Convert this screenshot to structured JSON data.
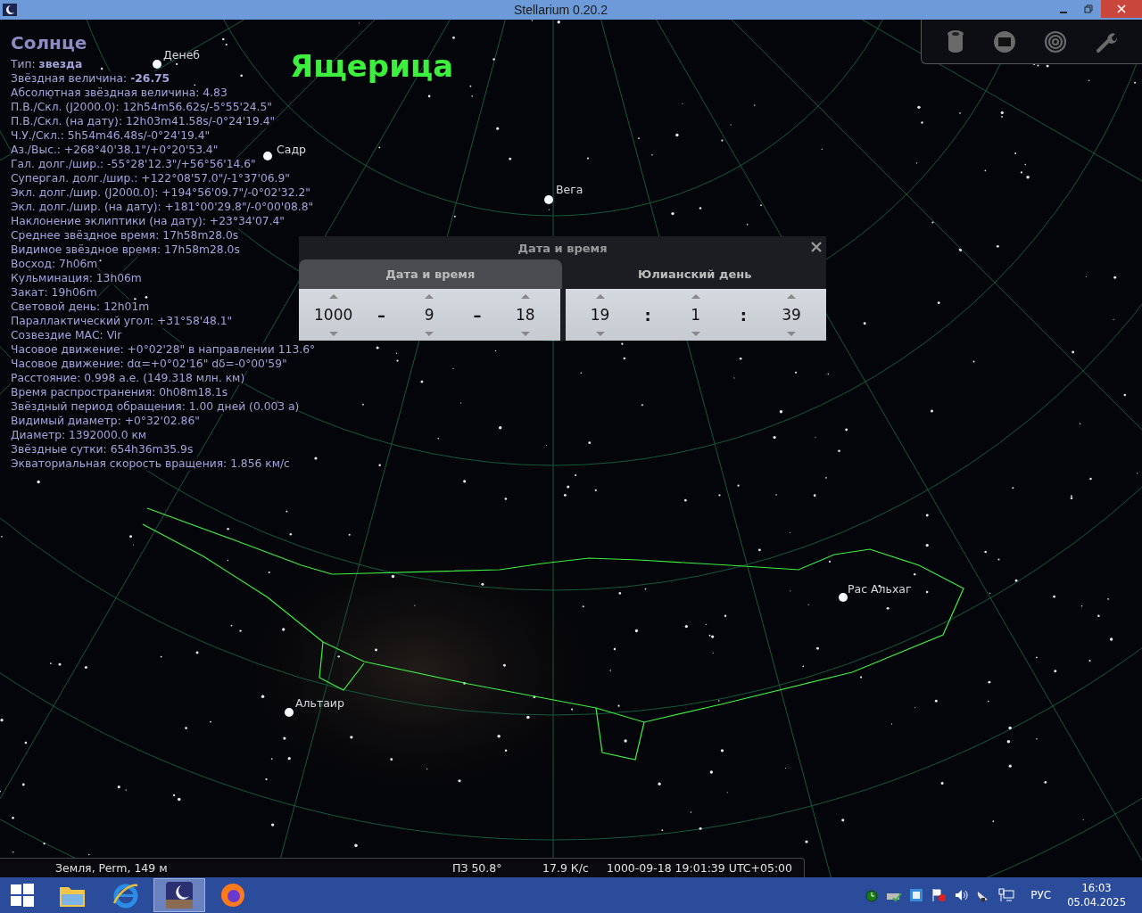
{
  "window": {
    "title": "Stellarium 0.20.2"
  },
  "info": {
    "name": "Солнце",
    "lines": [
      "Тип: **звезда**",
      "Звёздная величина: **-26.75**",
      "Абсолютная звёздная величина: 4.83",
      "П.В./Скл. (J2000.0): 12h54m56.62s/-5°55'24.5\"",
      "П.В./Скл. (на дату): 12h03m41.58s/-0°24'19.4\"",
      "Ч.У./Скл.: 5h54m46.48s/-0°24'19.4\"",
      "Аз./Выс.: +268°40'38.1\"/+0°20'53.4\"",
      "Гал. долг./шир.: -55°28'12.3\"/+56°56'14.6\"",
      "Супергал. долг./шир.: +122°08'57.0\"/-1°37'06.9\"",
      "Экл. долг./шир. (J2000.0): +194°56'09.7\"/-0°02'32.2\"",
      "Экл. долг./шир. (на дату): +181°00'29.8\"/-0°00'08.8\"",
      "Наклонение эклиптики (на дату): +23°34'07.4\"",
      "Среднее звёздное время: 17h58m28.0s",
      "Видимое звёздное время: 17h58m28.0s",
      "Восход: 7h06m",
      "Кульминация: 13h06m",
      "Закат: 19h06m",
      "Световой день: 12h01m",
      "Параллактический угол: +31°58'48.1\"",
      "Созвездие МАС: Vir",
      "Часовое движение: +0°02'28\" в направлении 113.6°",
      "Часовое движение: dα=+0°02'16\" dδ=-0°00'59\"",
      "Расстояние: 0.998 а.е. (149.318 млн. км)",
      "Время распространения: 0h08m18.1s",
      "Звёздный период обращения: 1.00 дней (0.003 а)",
      "Видимый диаметр: +0°32'02.86\"",
      "Диаметр: 1392000.0 км",
      "Звёздные сутки: 654h36m35.9s",
      "Экваториальная скорость вращения: 1.856 км/с"
    ]
  },
  "constellation": {
    "name": "Ящерица"
  },
  "star_labels": [
    {
      "label": "Денеб"
    },
    {
      "label": "Садр"
    },
    {
      "label": "Вега"
    },
    {
      "label": "Рас Альхаг"
    },
    {
      "label": "Альтаир"
    }
  ],
  "dialog": {
    "title": "Дата и время",
    "tabs": [
      {
        "label": "Дата и время",
        "selected": true
      },
      {
        "label": "Юлианский день",
        "selected": false
      }
    ],
    "date": [
      {
        "kind": "spin",
        "value": "1000"
      },
      {
        "kind": "sep",
        "value": "–"
      },
      {
        "kind": "spin",
        "value": "9"
      },
      {
        "kind": "sep",
        "value": "–"
      },
      {
        "kind": "spin",
        "value": "18"
      }
    ],
    "time": [
      {
        "kind": "spin",
        "value": "19"
      },
      {
        "kind": "sep",
        "value": ":"
      },
      {
        "kind": "spin",
        "value": "1"
      },
      {
        "kind": "sep",
        "value": ":"
      },
      {
        "kind": "spin",
        "value": "39"
      }
    ]
  },
  "status_bar": {
    "location": "Земля, Perm, 149 м",
    "fov": "ПЗ 50.8°",
    "fps": "17.9 К/с",
    "datetime": "1000-09-18 19:01:39 UTC+05:00"
  },
  "taskbar": {
    "apps": [
      {
        "kind": "explorer",
        "selected": false
      },
      {
        "kind": "browser",
        "selected": false
      },
      {
        "kind": "planetarium",
        "selected": true
      },
      {
        "kind": "firefox",
        "selected": false
      }
    ],
    "language": "РУС",
    "time": "16:03",
    "date": "05.04.2025"
  }
}
